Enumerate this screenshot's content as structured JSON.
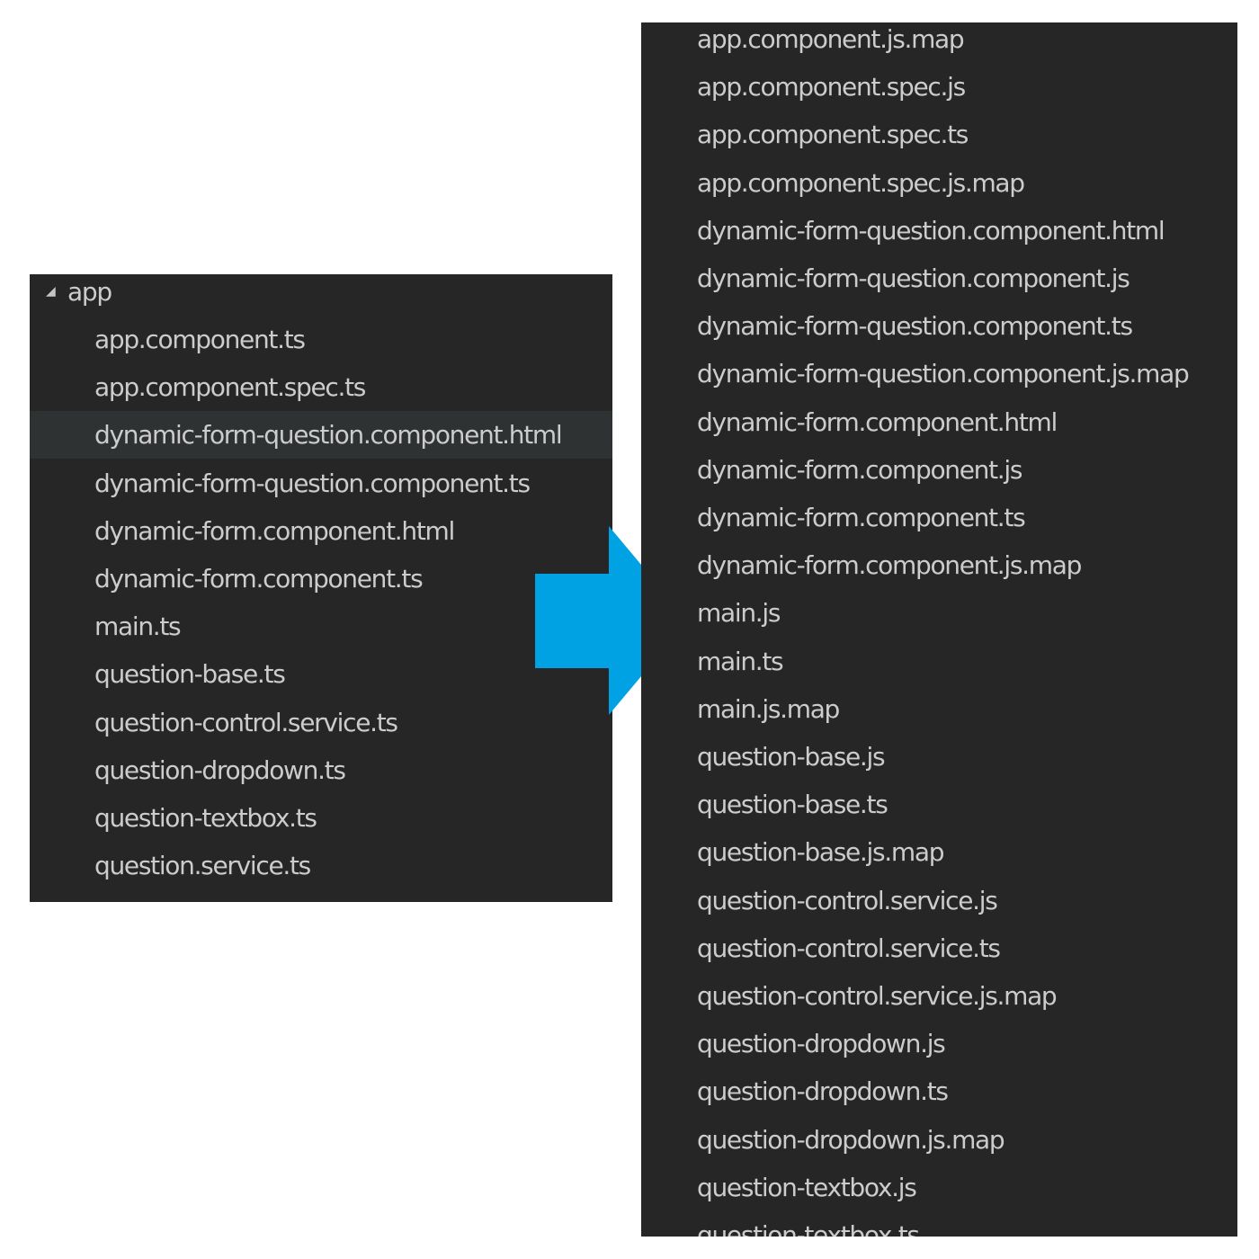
{
  "before": {
    "folder": {
      "twisty_glyph": "◢",
      "name": "app"
    },
    "files": [
      "app.component.ts",
      "app.component.spec.ts",
      "dynamic-form-question.component.html",
      "dynamic-form-question.component.ts",
      "dynamic-form.component.html",
      "dynamic-form.component.ts",
      "main.ts",
      "question-base.ts",
      "question-control.service.ts",
      "question-dropdown.ts",
      "question-textbox.ts",
      "question.service.ts"
    ],
    "selected_index": 2
  },
  "after": {
    "files": [
      "app.component.js.map",
      "app.component.spec.js",
      "app.component.spec.ts",
      "app.component.spec.js.map",
      "dynamic-form-question.component.html",
      "dynamic-form-question.component.js",
      "dynamic-form-question.component.ts",
      "dynamic-form-question.component.js.map",
      "dynamic-form.component.html",
      "dynamic-form.component.js",
      "dynamic-form.component.ts",
      "dynamic-form.component.js.map",
      "main.js",
      "main.ts",
      "main.js.map",
      "question-base.js",
      "question-base.ts",
      "question-base.js.map",
      "question-control.service.js",
      "question-control.service.ts",
      "question-control.service.js.map",
      "question-dropdown.js",
      "question-dropdown.ts",
      "question-dropdown.js.map",
      "question-textbox.js",
      "question-textbox.ts"
    ]
  },
  "colors": {
    "panel_background": "#262626",
    "selected_row": "#2f3233",
    "file_text": "#cccccc",
    "arrow": "#00a2e3"
  },
  "icons": {
    "expand": "triangle-expanded-icon",
    "arrow": "right-arrow-icon"
  }
}
